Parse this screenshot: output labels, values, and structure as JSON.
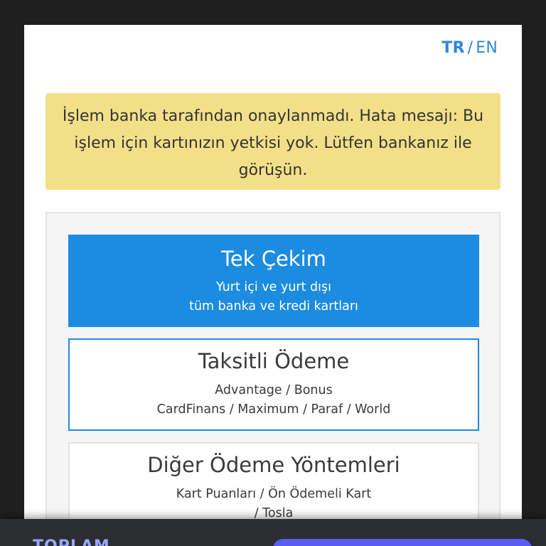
{
  "language": {
    "active": "TR",
    "separator": "/",
    "other": "EN"
  },
  "alert": {
    "message": "İşlem banka tarafından onaylanmadı. Hata mesajı: Bu işlem için kartınızın yetkisi yok. Lütfen bankanız ile görüşün."
  },
  "payment_options": [
    {
      "title": "Tek Çekim",
      "lines": [
        "Yurt içi ve yurt dışı",
        "tüm banka ve kredi kartları"
      ]
    },
    {
      "title": "Taksitli Ödeme",
      "lines": [
        "Advantage / Bonus",
        "CardFinans / Maximum / Paraf / World"
      ]
    },
    {
      "title": "Diğer Ödeme Yöntemleri",
      "lines": [
        "Kart Puanları / Ön Ödemeli Kart",
        "/ Tosla"
      ]
    }
  ],
  "footer": {
    "total_label": "TOPLAM"
  },
  "colors": {
    "accent": "#1b8ce0",
    "alert_bg": "#f4df89",
    "pay_button": "#5b5cf0"
  }
}
